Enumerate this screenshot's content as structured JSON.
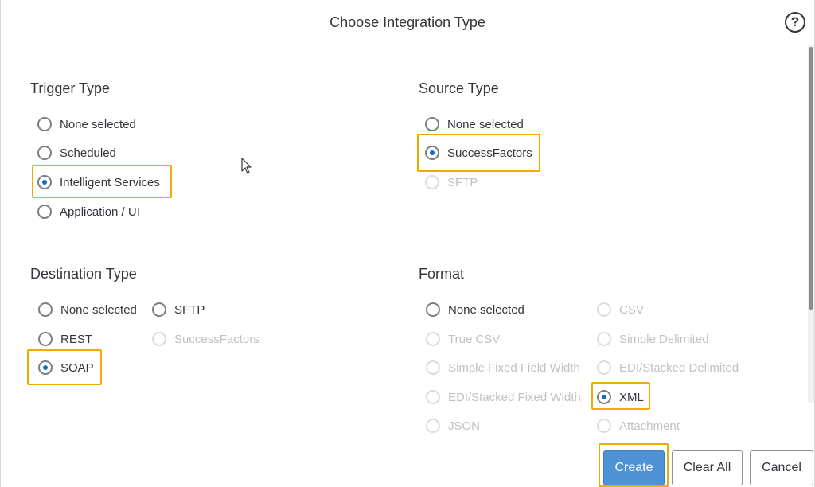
{
  "dialog": {
    "title": "Choose Integration Type",
    "help_icon": "question-circle-icon",
    "help_glyph": "?"
  },
  "trigger": {
    "title": "Trigger Type",
    "options": [
      {
        "label": "None selected",
        "checked": false,
        "disabled": false
      },
      {
        "label": "Scheduled",
        "checked": false,
        "disabled": false
      },
      {
        "label": "Intelligent Services",
        "checked": true,
        "disabled": false
      },
      {
        "label": "Application / UI",
        "checked": false,
        "disabled": false
      }
    ]
  },
  "source": {
    "title": "Source Type",
    "options": [
      {
        "label": "None selected",
        "checked": false,
        "disabled": false
      },
      {
        "label": "SuccessFactors",
        "checked": true,
        "disabled": false
      },
      {
        "label": "SFTP",
        "checked": false,
        "disabled": true
      }
    ]
  },
  "destination": {
    "title": "Destination Type",
    "options": [
      {
        "label": "None selected",
        "checked": false,
        "disabled": false
      },
      {
        "label": "SFTP",
        "checked": false,
        "disabled": false
      },
      {
        "label": "REST",
        "checked": false,
        "disabled": false
      },
      {
        "label": "SuccessFactors",
        "checked": false,
        "disabled": true
      },
      {
        "label": "SOAP",
        "checked": true,
        "disabled": false
      }
    ]
  },
  "format": {
    "title": "Format",
    "options": [
      {
        "label": "None selected",
        "checked": false,
        "disabled": false
      },
      {
        "label": "CSV",
        "checked": false,
        "disabled": true
      },
      {
        "label": "True CSV",
        "checked": false,
        "disabled": true
      },
      {
        "label": "Simple Delimited",
        "checked": false,
        "disabled": true
      },
      {
        "label": "Simple Fixed Field Width",
        "checked": false,
        "disabled": true
      },
      {
        "label": "EDI/Stacked Delimited",
        "checked": false,
        "disabled": true
      },
      {
        "label": "EDI/Stacked Fixed Width",
        "checked": false,
        "disabled": true
      },
      {
        "label": "XML",
        "checked": true,
        "disabled": false
      },
      {
        "label": "JSON",
        "checked": false,
        "disabled": true
      },
      {
        "label": "Attachment",
        "checked": false,
        "disabled": true
      }
    ]
  },
  "footer": {
    "create_label": "Create",
    "clear_all_label": "Clear All",
    "cancel_label": "Cancel"
  },
  "colors": {
    "highlight": "#f0ab00",
    "radio_selected": "#0a6ed1",
    "primary_button": "#4f92d6",
    "disabled_text": "#bfc2c4"
  }
}
